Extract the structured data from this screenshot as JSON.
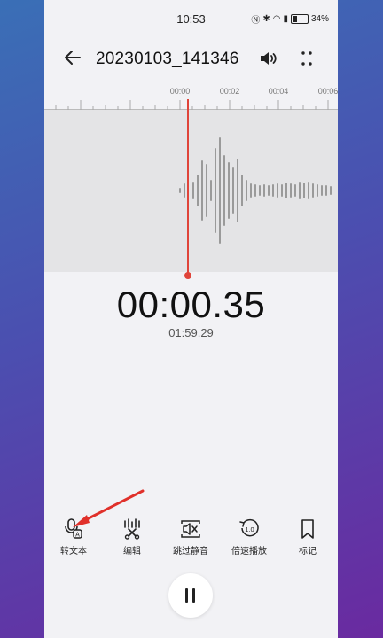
{
  "status": {
    "time": "10:53",
    "battery": "34%"
  },
  "header": {
    "title": "20230103_141346"
  },
  "timeline": {
    "ticks": [
      "00:00",
      "00:02",
      "00:04",
      "00:06"
    ]
  },
  "player": {
    "elapsed": "00:00.35",
    "total": "01:59.29"
  },
  "tools": [
    {
      "label": "转文本",
      "icon": "mic-text-icon"
    },
    {
      "label": "编辑",
      "icon": "scissors-wave-icon"
    },
    {
      "label": "跳过静音",
      "icon": "skip-mute-icon"
    },
    {
      "label": "倍速播放",
      "icon": "speed-icon"
    },
    {
      "label": "标记",
      "icon": "bookmark-icon"
    }
  ],
  "speed_badge": "1.0",
  "colors": {
    "playhead": "#e0443a",
    "arrow": "#e0302a"
  }
}
